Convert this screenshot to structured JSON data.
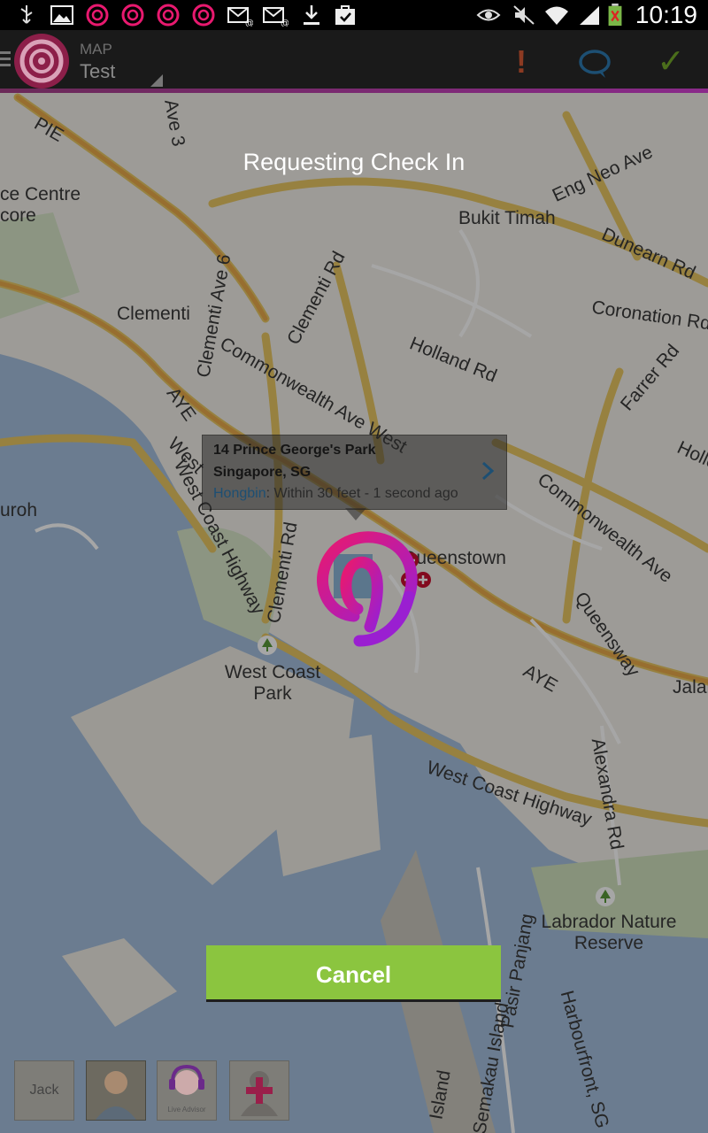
{
  "status_bar": {
    "time": "10:19",
    "icons": [
      "usb-icon",
      "image-icon",
      "app-notification-icon",
      "app-notification-icon",
      "app-notification-icon",
      "app-notification-icon",
      "email-icon",
      "email-icon",
      "download-icon",
      "task-icon",
      "eye-icon",
      "mute-icon",
      "wifi-icon",
      "signal-icon",
      "battery-icon"
    ]
  },
  "action_bar": {
    "subtitle": "MAP",
    "title": "Test",
    "actions": [
      "alert-icon",
      "chat-icon",
      "checkmark-icon"
    ]
  },
  "map": {
    "labels": [
      "PIE",
      "Ave 3",
      "ce Centre",
      "core",
      "Eng Neo Ave",
      "Bukit Timah",
      "Dunearn Rd",
      "Clementi Ave 6",
      "Clementi Rd",
      "Clementi",
      "Coronation Rd",
      "Holland Rd",
      "Farrer Rd",
      "Commonwealth Ave West",
      "AYE",
      "West Coast Highway",
      "West",
      "uroh",
      "Clementi Rd",
      "Queenstown",
      "Commonwealth Ave",
      "Queensway",
      "AYE",
      "Jalan",
      "West Coast Park",
      "West Coast Highway",
      "Alexandra Rd",
      "Labrador Nature Reserve",
      "Harbourfront, SG",
      "Pasir Panjang",
      "Semakau Island",
      "Island",
      "Holle"
    ]
  },
  "info_window": {
    "address_line1": "14 Prince George's Park",
    "address_line2": "Singapore, SG",
    "user": "Hongbin",
    "detail": ": Within 30 feet - 1 second ago"
  },
  "overlay": {
    "heading": "Requesting Check In",
    "cancel_label": "Cancel"
  },
  "members": [
    {
      "name": "Jack"
    },
    {
      "name": ""
    },
    {
      "name": "Live Advisor"
    },
    {
      "name": ""
    }
  ],
  "colors": {
    "accent_green": "#8bc53f",
    "brand_pink": "#e8196f",
    "brand_purple": "#9a1fd1"
  }
}
